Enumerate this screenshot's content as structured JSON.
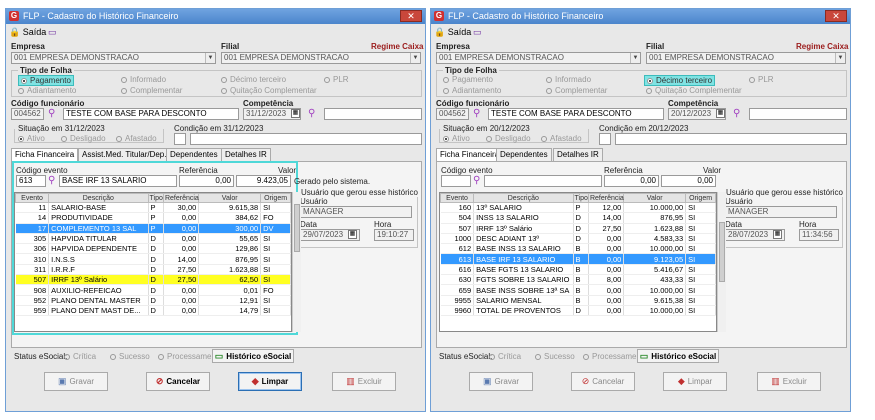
{
  "window": {
    "title": "FLP - Cadastro do Histórico Financeiro",
    "close": "✕"
  },
  "toolbar": {
    "exit_label": "Saída"
  },
  "labels": {
    "empresa": "Empresa",
    "filial": "Filial",
    "regime": "Regime Caixa",
    "tipo_folha": "Tipo de Folha",
    "codigo_funcionario": "Código funcionário",
    "competencia": "Competência",
    "codigo_evento": "Código evento",
    "referencia": "Referência",
    "valor": "Valor",
    "usuario_group": "Usuário que gerou esse histórico",
    "usuario": "Usuário",
    "data": "Data",
    "hora": "Hora",
    "status_esocial": "Status eSocial:"
  },
  "radios": {
    "pagamento": "Pagamento",
    "informado": "Informado",
    "decimo": "Décimo terceiro",
    "plr": "PLR",
    "adiantamento": "Adiantamento",
    "complementar": "Complementar",
    "quitacao": "Quitação Complementar"
  },
  "situacao_radios": {
    "ativo": "Ativo",
    "desligado": "Desligado",
    "afastado": "Afastado"
  },
  "tabs": [
    "Ficha Financeira",
    "Assist.Med. Titular/Dep.",
    "Dependentes",
    "Detalhes IR"
  ],
  "tabs_right": [
    "Ficha Financeira",
    "Dependentes",
    "Detalhes IR"
  ],
  "grid_headers": [
    "Evento",
    "Descrição",
    "Tipo",
    "Referência",
    "Valor",
    "Origem"
  ],
  "esocial": {
    "critica": "Crítica",
    "sucesso": "Sucesso",
    "processamento": "Processamento",
    "historico": "Histórico eSocial"
  },
  "buttons": {
    "gravar": "Gravar",
    "cancelar": "Cancelar",
    "limpar": "Limpar",
    "excluir": "Excluir"
  },
  "left": {
    "empresa": "001 EMPRESA DEMONSTRACAO",
    "filial": "001 EMPRESA DEMONSTRACAO",
    "func_code": "004562",
    "func_name": "TESTE COM BASE PARA DESCONTO",
    "competencia": "31/12/2023",
    "situacao_em": "Situação em 31/12/2023",
    "condicao_em": "Condição em 31/12/2023",
    "evento_code": "613",
    "evento_desc": "BASE IRF 13 SALARIO",
    "referencia": "0,00",
    "valor": "9.423,05",
    "gerado": "Gerado pelo sistema.",
    "usuario": "MANAGER",
    "data": "29/07/2023",
    "hora": "19:10:27",
    "rows": [
      [
        "11",
        "SALARIO-BASE",
        "P",
        "30,00",
        "9.615,38",
        "SI"
      ],
      [
        "14",
        "PRODUTIVIDADE",
        "P",
        "0,00",
        "384,62",
        "FO"
      ],
      [
        "17",
        "COMPLEMENTO 13 SAL",
        "P",
        "0,00",
        "300,00",
        "DV"
      ],
      [
        "305",
        "HAPVIDA TITULAR",
        "D",
        "0,00",
        "55,65",
        "SI"
      ],
      [
        "306",
        "HAPVIDA DEPENDENTE",
        "D",
        "0,00",
        "129,86",
        "SI"
      ],
      [
        "310",
        "I.N.S.S",
        "D",
        "14,00",
        "876,95",
        "SI"
      ],
      [
        "311",
        "I.R.R.F",
        "D",
        "27,50",
        "1.623,88",
        "SI"
      ],
      [
        "507",
        "IRRF 13º Salário",
        "D",
        "27,50",
        "62,50",
        "SI"
      ],
      [
        "908",
        "AUXILIO-REFEICAO",
        "D",
        "0,00",
        "0,01",
        "FO"
      ],
      [
        "952",
        "PLANO DENTAL MASTER",
        "D",
        "0,00",
        "12,91",
        "SI"
      ],
      [
        "959",
        "PLANO DENT MAST DE...",
        "D",
        "0,00",
        "14,79",
        "SI"
      ]
    ]
  },
  "right": {
    "empresa": "001 EMPRESA DEMONSTRACAO",
    "filial": "001 EMPRESA DEMONSTRACAO",
    "func_code": "004562",
    "func_name": "TESTE COM BASE PARA DESCONTO",
    "competencia": "20/12/2023",
    "situacao_em": "Situação em 20/12/2023",
    "condicao_em": "Condição em 20/12/2023",
    "referencia": "0,00",
    "valor": "0,00",
    "usuario": "MANAGER",
    "data": "28/07/2023",
    "hora": "11:34:56",
    "rows": [
      [
        "160",
        "13º SALARIO",
        "P",
        "12,00",
        "10.000,00",
        "SI"
      ],
      [
        "504",
        "INSS 13 SALARIO",
        "D",
        "14,00",
        "876,95",
        "SI"
      ],
      [
        "507",
        "IRRF 13º Salário",
        "D",
        "27,50",
        "1.623,88",
        "SI"
      ],
      [
        "1000",
        "DESC ADIANT 13º",
        "D",
        "0,00",
        "4.583,33",
        "SI"
      ],
      [
        "612",
        "BASE INSS 13 SALARIO",
        "B",
        "0,00",
        "10.000,00",
        "SI"
      ],
      [
        "613",
        "BASE IRF 13 SALARIO",
        "B",
        "0,00",
        "9.123,05",
        "SI"
      ],
      [
        "616",
        "BASE FGTS 13 SALARIO",
        "B",
        "0,00",
        "5.416,67",
        "SI"
      ],
      [
        "630",
        "FGTS SOBRE 13 SALARIO",
        "B",
        "8,00",
        "433,33",
        "SI"
      ],
      [
        "659",
        "BASE INSS SOBRE 13ª SA",
        "B",
        "0,00",
        "10.000,00",
        "SI"
      ],
      [
        "9955",
        "SALARIO MENSAL",
        "B",
        "0,00",
        "9.615,38",
        "SI"
      ],
      [
        "9960",
        "TOTAL DE PROVENTOS",
        "D",
        "0,00",
        "10.000,00",
        "SI"
      ]
    ]
  }
}
